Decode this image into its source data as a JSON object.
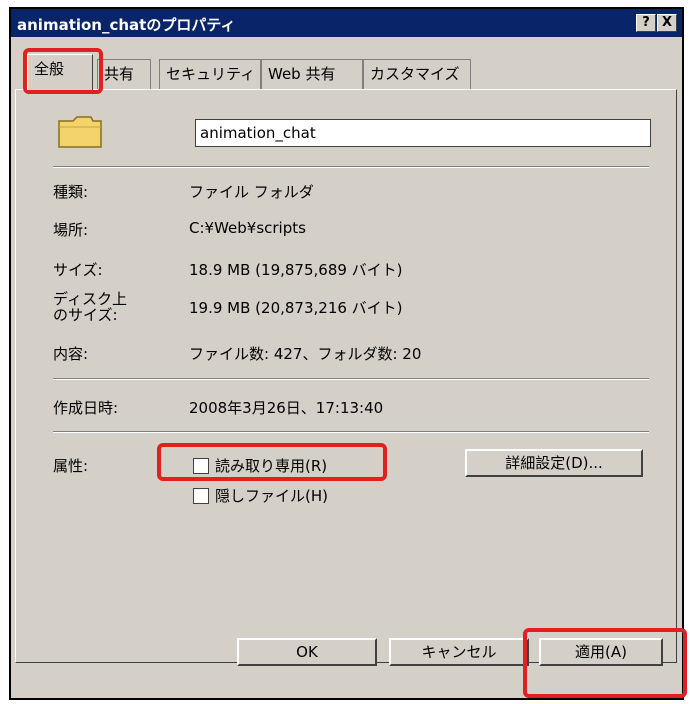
{
  "window": {
    "title": "animation_chatのプロパティ",
    "help_label": "?",
    "close_label": "X"
  },
  "tabs": [
    {
      "label": "全般"
    },
    {
      "label": "共有"
    },
    {
      "label": "セキュリティ"
    },
    {
      "label": "Web 共有"
    },
    {
      "label": "カスタマイズ"
    }
  ],
  "general": {
    "folder_icon": "folder-icon",
    "name_value": "animation_chat",
    "properties": [
      {
        "label": "種類:",
        "value": "ファイル フォルダ"
      },
      {
        "label": "場所:",
        "value": "C:¥Web¥scripts"
      },
      {
        "label": "サイズ:",
        "value": "18.9 MB (19,875,689 バイト)"
      },
      {
        "label": "ディスク上のサイズ:",
        "value": "19.9 MB (20,873,216 バイト)"
      },
      {
        "label": "内容:",
        "value": "ファイル数: 427、フォルダ数: 20"
      },
      {
        "label": "作成日時:",
        "value": "2008年3月26日、17:13:40"
      }
    ],
    "attributes_label": "属性:",
    "readonly_label": "読み取り専用(R)",
    "hidden_label": "隠しファイル(H)",
    "advanced_button": "詳細設定(D)..."
  },
  "buttons": {
    "ok": "OK",
    "cancel": "キャンセル",
    "apply": "適用(A)"
  },
  "highlight_color": "#e32020"
}
